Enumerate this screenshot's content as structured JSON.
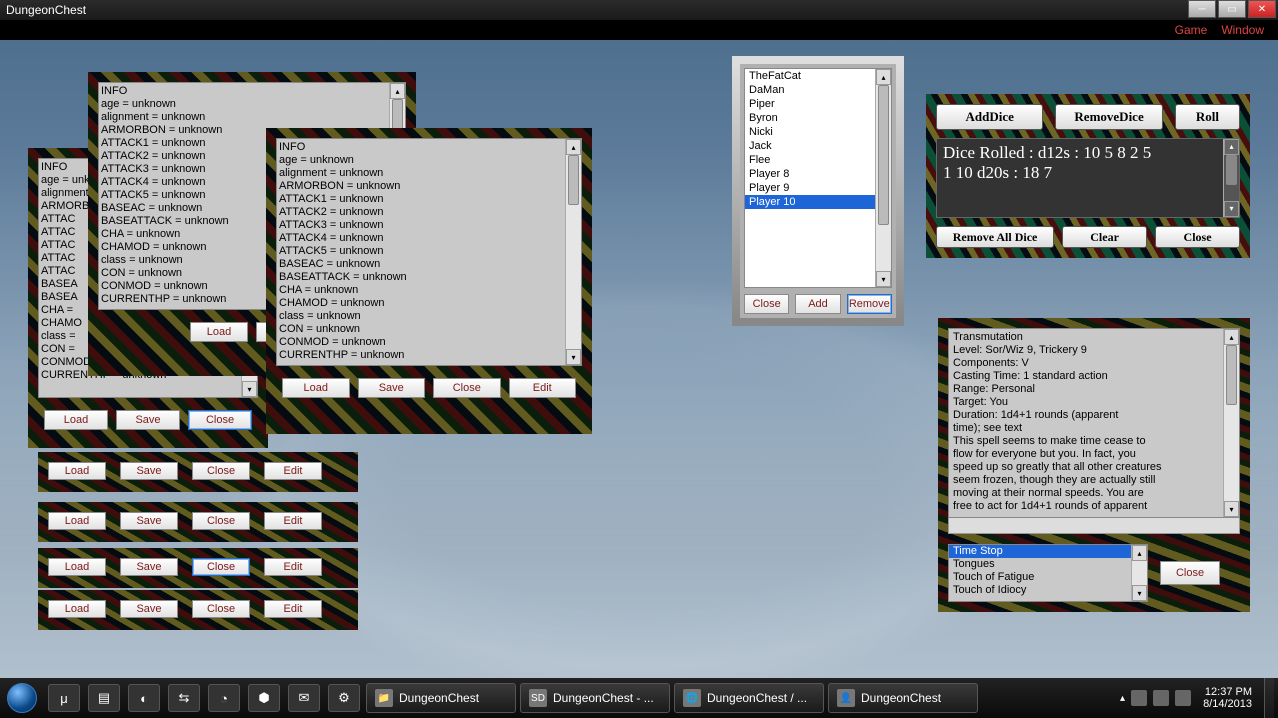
{
  "window": {
    "title": "DungeonChest"
  },
  "menubar": {
    "game": "Game",
    "window": "Window"
  },
  "info_lines": "INFO\nage = unknown\nalignment = unknown\nARMORBON = unknown\nATTACK1 = unknown\nATTACK2 = unknown\nATTACK3 = unknown\nATTACK4 = unknown\nATTACK5 = unknown\nBASEAC = unknown\nBASEATTACK = unknown\nCHA = unknown\nCHAMOD = unknown\nclass = unknown\nCON = unknown\nCONMOD = unknown\nCURRENTHP = unknown",
  "info_lines_b": "INFO\nage = unknown\nalignment = unknown\nARMORBON\nATTAC\nATTAC\nATTAC\nATTAC\nATTAC\nBASEA\nBASEA\nCHA =\nCHAMO\nclass =\nCON =\nCONMOD = unknown\nCURRENTHP = unknown",
  "buttons": {
    "load": "Load",
    "save": "Save",
    "close": "Close",
    "edit": "Edit"
  },
  "players": {
    "items": [
      "TheFatCat",
      "DaMan",
      "Piper",
      "Byron",
      "Nicki",
      "Jack",
      "Flee",
      "Player 8",
      "Player 9",
      "Player 10"
    ],
    "selected": 9,
    "close": "Close",
    "add": "Add",
    "remove": "Remove"
  },
  "dice": {
    "add": "AddDice",
    "remove": "RemoveDice",
    "roll": "Roll",
    "output": "Dice Rolled : d12s : 10 5 8 2 5\n1 10 d20s : 18 7",
    "remove_all": "Remove All Dice",
    "clear": "Clear",
    "close": "Close"
  },
  "spell": {
    "text": "Transmutation\nLevel: Sor/Wiz 9, Trickery 9\nComponents: V\nCasting Time: 1 standard action\nRange: Personal\nTarget: You\nDuration: 1d4+1 rounds (apparent\ntime); see text\nThis spell seems to make time cease to\nflow for everyone but you. In fact, you\nspeed up so greatly that all other creatures\nseem frozen, though they are actually still\nmoving at their normal speeds. You are\nfree to act for 1d4+1 rounds of apparent",
    "list": [
      "Time Stop",
      "Tongues",
      "Touch of Fatigue",
      "Touch of Idiocy"
    ],
    "selected": 0,
    "close": "Close"
  },
  "taskbar": {
    "tasks": [
      {
        "label": "DungeonChest"
      },
      {
        "label": "DungeonChest - ..."
      },
      {
        "label": "DungeonChest / ..."
      },
      {
        "label": "DungeonChest"
      }
    ],
    "time": "12:37 PM",
    "date": "8/14/2013"
  }
}
